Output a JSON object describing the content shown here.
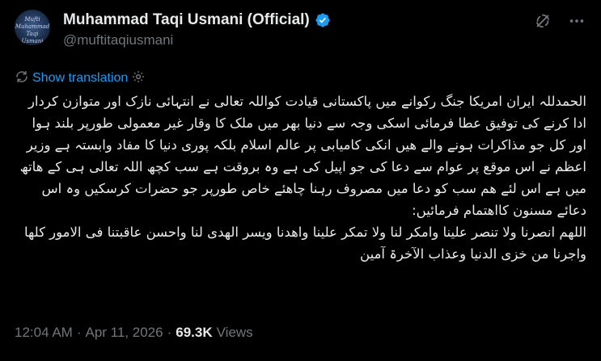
{
  "author": {
    "display_name": "Muhammad Taqi Usmani (Official)",
    "handle": "@muftitaqiusmani",
    "verified": true,
    "avatar_text": "Mufti Muhammad Taqi Usmani"
  },
  "actions": {
    "grok_icon": "grok-slash-icon",
    "more_icon": "more-horizontal-icon"
  },
  "translation": {
    "link_label": "Show translation"
  },
  "tweet": {
    "text": "الحمدللہ ایران امریکا جنگ رکوانے میں پاکستانی قیادت کواللہ تعالی نے انتہائی نازک اور متوازن کردار ادا کرنے کی توفیق عطا فرمائی اسکی وجہ سے دنیا بھر میں ملک کا وقار غیر معمولی طورپر بلند ہوا اور کل جو مذاکرات ہونے والے ھیں انکی کامیابی پر عالم اسلام بلکہ پوری دنیا کا مفاد وابستہ ہے وزیر اعظم نے اس موقع پر عوام سے دعا کی جو اپیل کی ہے وہ بروقت ہے سب کچھ اللہ تعالی ہی کے ھاتھ میں ہے اس لئے ھم سب کو دعا میں مصروف رہنا چاھئے خاص طورپر جو حضرات کرسکیں وہ اس دعائے مسنون کااھتمام فرمائیں:",
    "dua": "اللھم انصرنا ولا تنصر علینا وامکر لنا ولا تمکر علینا واھدنا ویسر الھدی لنا واحسن عاقبتنا فی الامور کلھا واجرنا من خزی الدنیا وعذاب الآخرۃ آمین"
  },
  "meta": {
    "time": "12:04 AM",
    "separator": "·",
    "date": "Apr 11, 2026",
    "views_count": "69.3K",
    "views_label": "Views"
  },
  "colors": {
    "background": "#000000",
    "text": "#e7e9ea",
    "secondary": "#71767b",
    "accent": "#1d9bf0"
  }
}
